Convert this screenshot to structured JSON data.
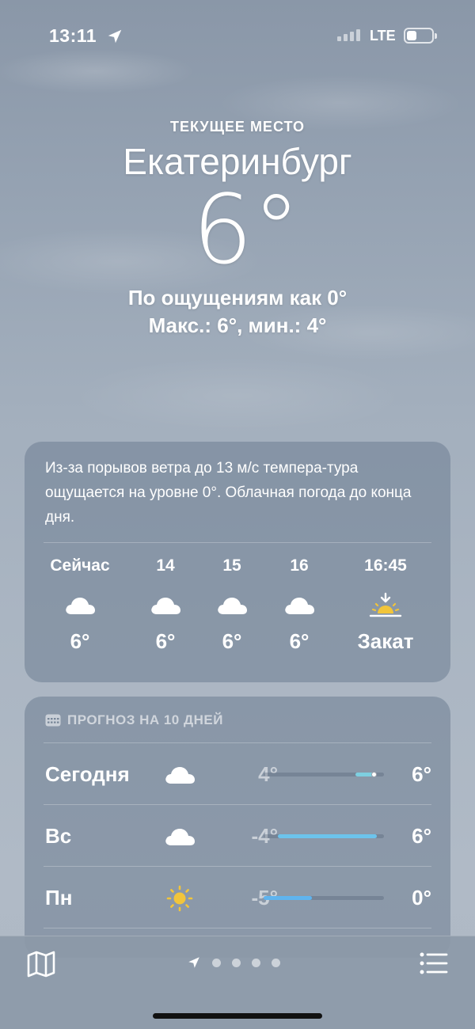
{
  "status_bar": {
    "time": "13:11",
    "network": "LTE",
    "icons": [
      "location-arrow-icon",
      "signal-icon",
      "battery-icon"
    ]
  },
  "hero": {
    "location_label": "ТЕКУЩЕЕ МЕСТО",
    "city": "Екатеринбург",
    "temperature": "6°",
    "feels_like": "По ощущениям как 0°",
    "hi_lo": "Макс.: 6°, мин.: 4°"
  },
  "hourly_card": {
    "summary": "Из-за порывов ветра до 13 м/с темпера-тура ощущается на уровне 0°. Облачная погода до конца дня.",
    "hours": [
      {
        "label": "Сейчас",
        "icon": "cloud-icon",
        "value": "6°"
      },
      {
        "label": "14",
        "icon": "cloud-icon",
        "value": "6°"
      },
      {
        "label": "15",
        "icon": "cloud-icon",
        "value": "6°"
      },
      {
        "label": "16",
        "icon": "cloud-icon",
        "value": "6°"
      },
      {
        "label": "16:45",
        "icon": "sunset-icon",
        "value": "Закат"
      }
    ]
  },
  "forecast_card": {
    "header": "ПРОГНОЗ НА 10 ДНЕЙ",
    "days": [
      {
        "day": "Сегодня",
        "icon": "cloud-icon",
        "low": "4°",
        "high": "6°",
        "range_start": 0.76,
        "range_end": 0.92,
        "current": 0.92,
        "bar_color": "#7ecfe0"
      },
      {
        "day": "Вс",
        "icon": "cloud-icon",
        "low": "-4°",
        "high": "6°",
        "range_start": 0.12,
        "range_end": 0.94,
        "current": null,
        "bar_color": "#6cc3ec"
      },
      {
        "day": "Пн",
        "icon": "sun-icon",
        "low": "-5°",
        "high": "0°",
        "range_start": 0.0,
        "range_end": 0.4,
        "current": null,
        "bar_color": "#5fb4ef"
      }
    ]
  },
  "toolbar": {
    "map": "map-icon",
    "pages": 4,
    "list": "list-icon"
  },
  "colors": {
    "accent_sun": "#f2c53a",
    "card_bg": "rgba(110,125,145,0.55)"
  }
}
